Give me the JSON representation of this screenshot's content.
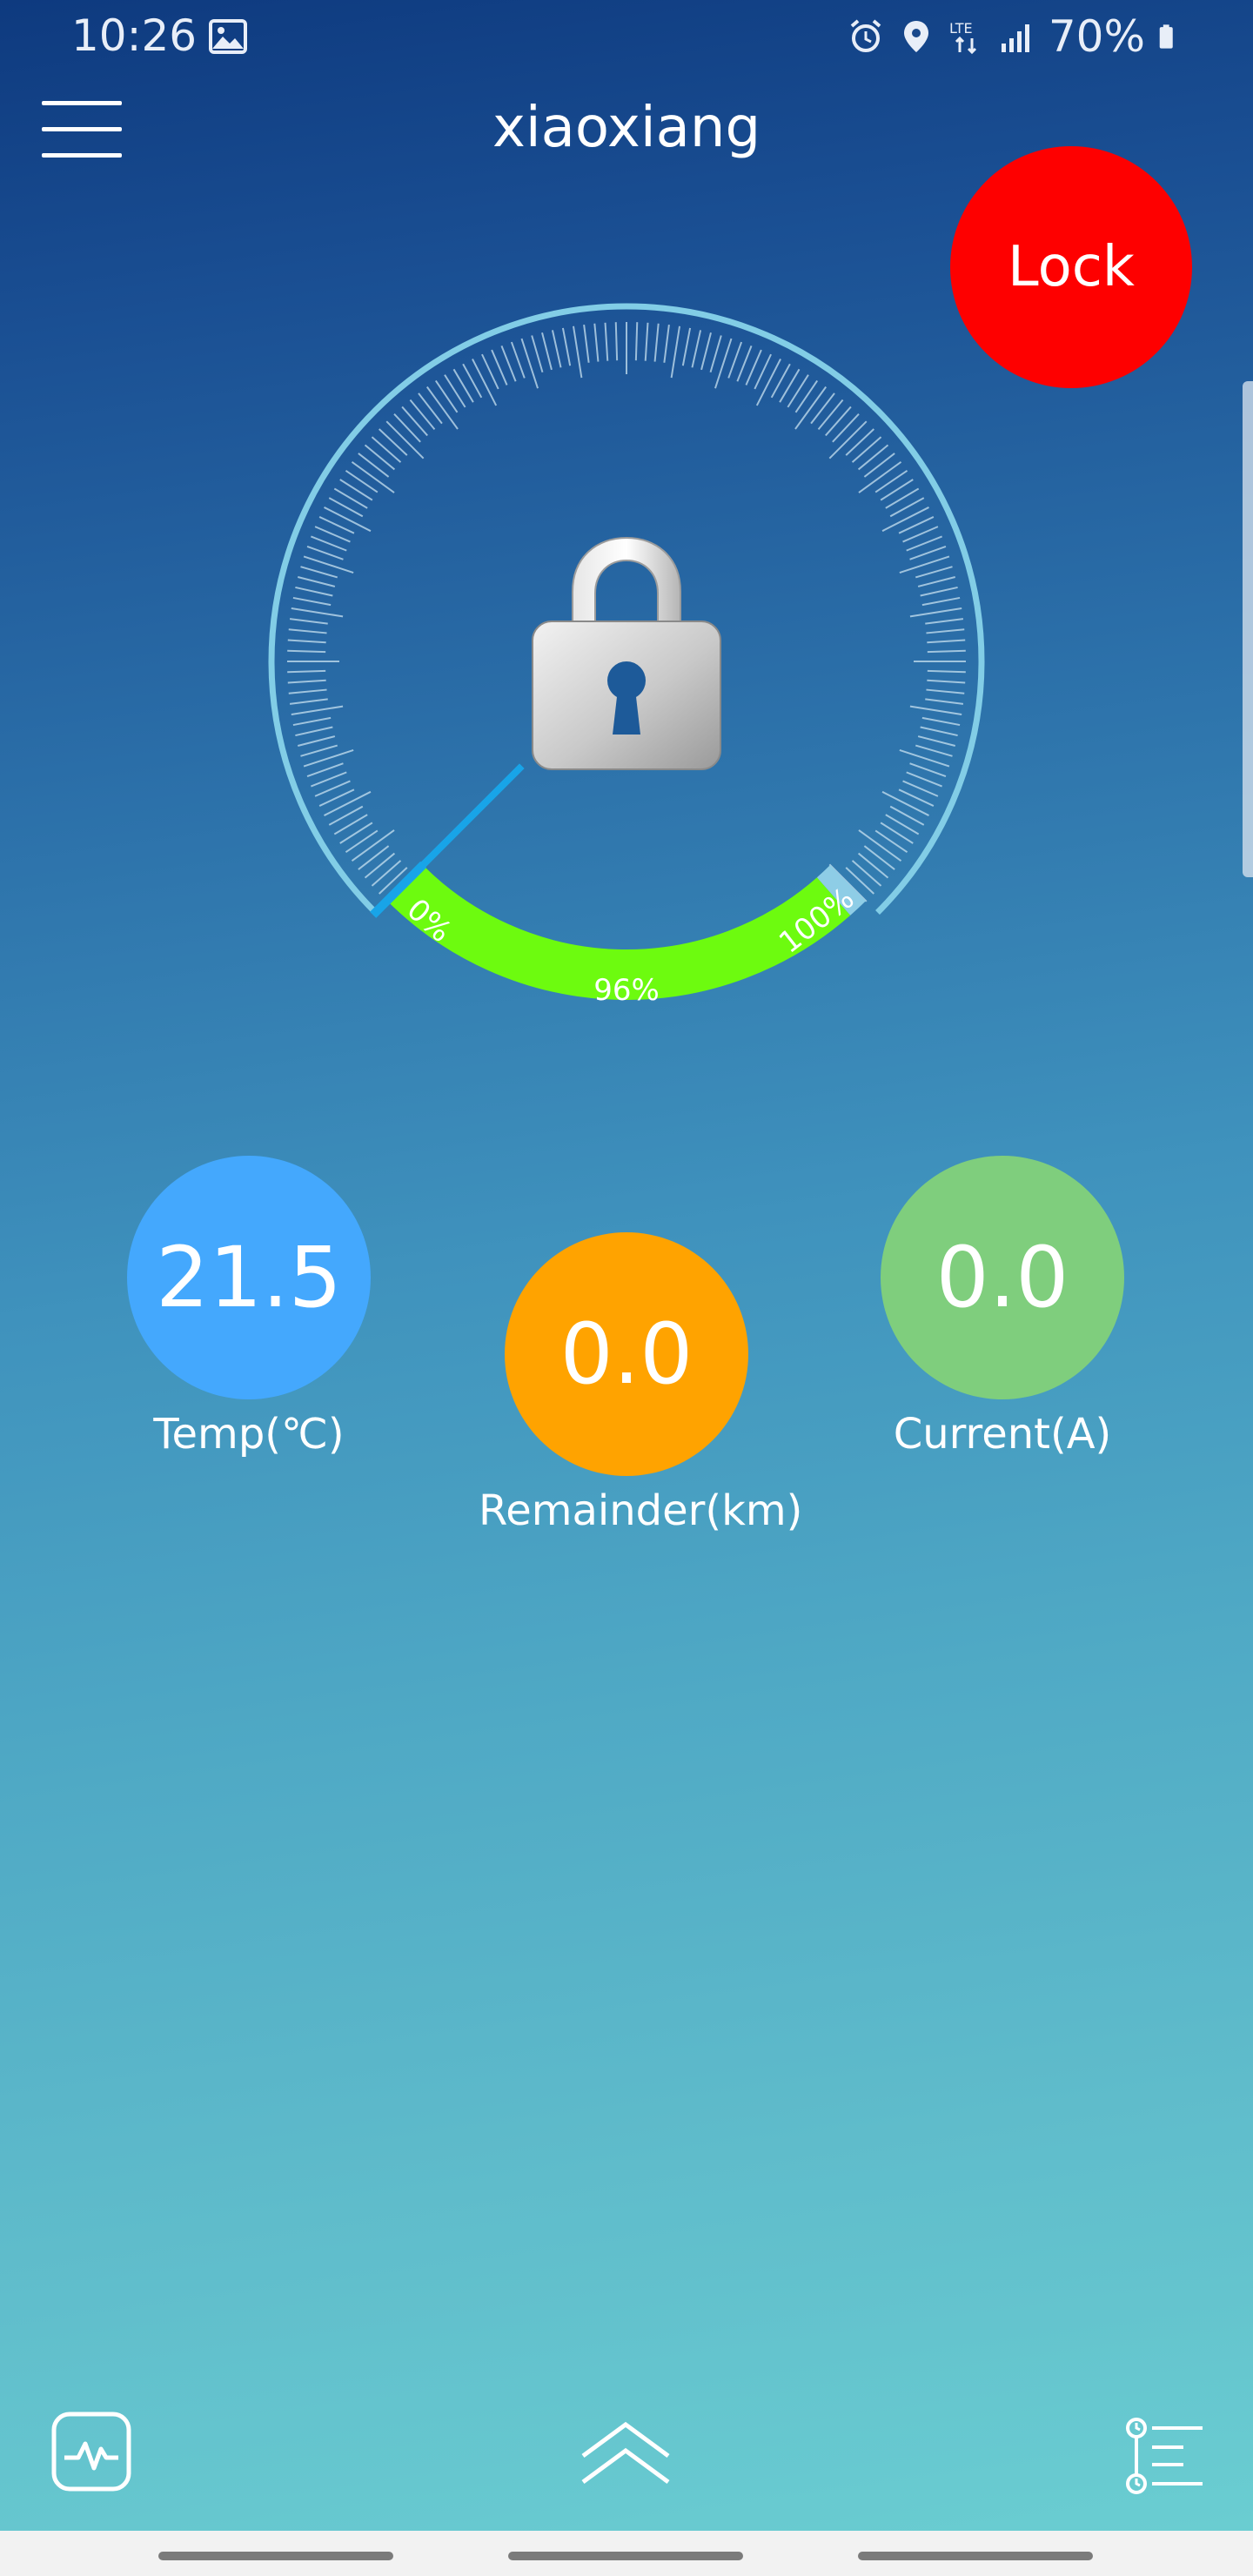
{
  "status_bar": {
    "time": "10:26",
    "battery_text": "70%",
    "icons": [
      "image-icon",
      "alarm-icon",
      "location-icon",
      "lte-icon",
      "signal-icon",
      "battery-icon"
    ]
  },
  "header": {
    "title": "xiaoxiang",
    "menu_icon": "hamburger-menu-icon",
    "lock_label": "Lock",
    "lock_color": "#fe0000"
  },
  "gauge": {
    "min_label": "0%",
    "max_label": "100%",
    "value_label": "96%",
    "fill_fraction": 0.96,
    "fill_color": "#6dfb0f",
    "center_icon": "padlock-icon"
  },
  "stats": {
    "temp": {
      "value": "21.5",
      "label": "Temp(℃)",
      "color": "#44a8fd"
    },
    "remainder": {
      "value": "0.0",
      "label": "Remainder(km)",
      "color": "#ffa300"
    },
    "current": {
      "value": "0.0",
      "label": "Current(A)",
      "color": "#7fce7d"
    }
  },
  "bottom_bar": {
    "left_icon": "pulse-icon",
    "center_icon": "chevron-up-icon",
    "right_icon": "timeline-list-icon"
  }
}
